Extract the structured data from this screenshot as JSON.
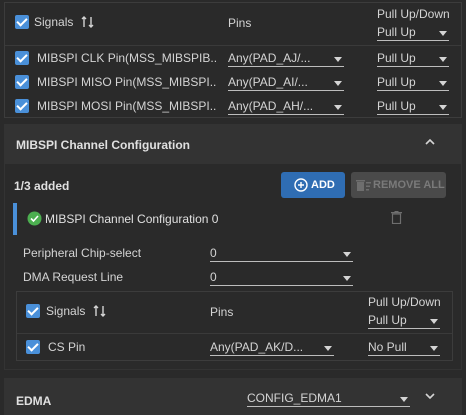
{
  "signals_table": {
    "header_signals": "Signals",
    "header_pins": "Pins",
    "header_pull": "Pull Up/Down",
    "header_pull_value": "Pull Up",
    "rows": [
      {
        "signal": "MIBSPI CLK Pin(MSS_MIBSPIB...",
        "pin": "Any(PAD_AJ/...",
        "pull": "Pull Up"
      },
      {
        "signal": "MIBSPI MISO Pin(MSS_MIBSPI...",
        "pin": "Any(PAD_AI/...",
        "pull": "Pull Up"
      },
      {
        "signal": "MIBSPI MOSI Pin(MSS_MIBSPI...",
        "pin": "Any(PAD_AH/...",
        "pull": "Pull Up"
      }
    ]
  },
  "channel_section": {
    "title": "MIBSPI Channel Configuration",
    "added_count": "1/3 added",
    "add_label": "ADD",
    "remove_all_label": "REMOVE ALL",
    "item_title": "MIBSPI Channel Configuration 0",
    "peripheral_cs_label": "Peripheral Chip-select",
    "peripheral_cs_value": "0",
    "dma_label": "DMA Request Line",
    "dma_value": "0",
    "inner_table": {
      "header_signals": "Signals",
      "header_pins": "Pins",
      "header_pull": "Pull Up/Down",
      "header_pull_value": "Pull Up",
      "rows": [
        {
          "signal": "CS Pin",
          "pin": "Any(PAD_AK/D...",
          "pull": "No Pull"
        }
      ]
    }
  },
  "edma_section": {
    "title": "EDMA",
    "value": "CONFIG_EDMA1"
  },
  "colors": {
    "accent": "#4a90d9",
    "add_button": "#2f6db3",
    "success": "#4caf50",
    "panel_bg": "#2a2a2a",
    "header_bg": "#333333"
  }
}
